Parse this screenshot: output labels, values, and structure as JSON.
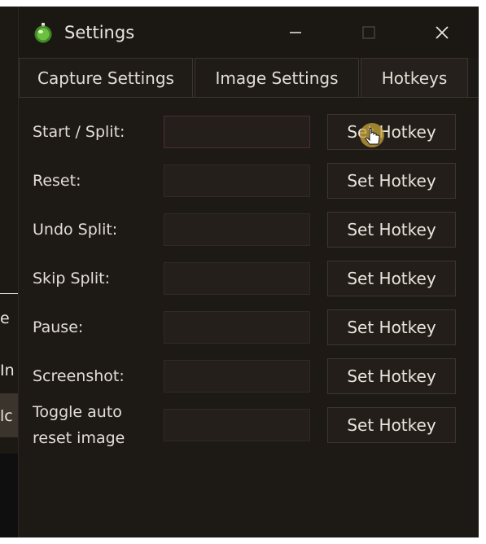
{
  "window": {
    "title": "Settings",
    "controls": {
      "minimize": "minimize",
      "maximize": "maximize",
      "close": "close"
    }
  },
  "tabs": [
    {
      "label": "Capture Settings",
      "selected": false
    },
    {
      "label": "Image Settings",
      "selected": false
    },
    {
      "label": "Hotkeys",
      "selected": true
    }
  ],
  "hotkeys": [
    {
      "label": "Start / Split:",
      "value": "",
      "button": "Set Hotkey"
    },
    {
      "label": "Reset:",
      "value": "",
      "button": "Set Hotkey"
    },
    {
      "label": "Undo Split:",
      "value": "",
      "button": "Set Hotkey"
    },
    {
      "label": "Skip Split:",
      "value": "",
      "button": "Set Hotkey"
    },
    {
      "label": "Pause:",
      "value": "",
      "button": "Set Hotkey"
    },
    {
      "label": "Screenshot:",
      "value": "",
      "button": "Set Hotkey"
    },
    {
      "label": "Toggle auto reset image",
      "value": "",
      "button": "Set Hotkey"
    }
  ],
  "background_app": {
    "chars": [
      "e",
      "In",
      "lc"
    ]
  },
  "colors": {
    "window_bg": "#1d1915",
    "text": "#e2ddd5",
    "icon_green": "#5aa832",
    "cursor_highlight": "#c7a43a"
  },
  "icons": {
    "app": "app-logo-icon",
    "minimize": "minimize-icon",
    "maximize": "maximize-icon",
    "close": "close-icon",
    "cursor": "hand-cursor-icon"
  }
}
